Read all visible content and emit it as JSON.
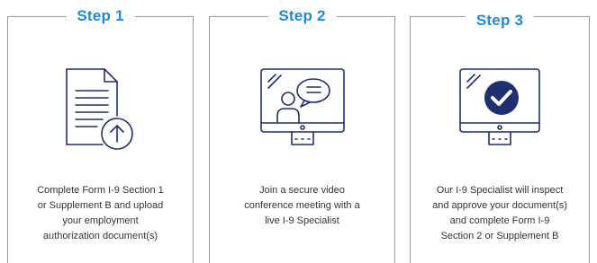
{
  "colors": {
    "accent": "#1f8bd6",
    "icon_stroke": "#1f2f6f",
    "check_fill": "#1f2f6f",
    "border": "#9a9a9a",
    "text": "#333333"
  },
  "steps": [
    {
      "title": "Step 1",
      "icon": "document-upload-icon",
      "lines": [
        "Complete Form I-9 Section 1",
        "or Supplement B and upload",
        "your employment",
        "authorization document(s)"
      ]
    },
    {
      "title": "Step 2",
      "icon": "video-conference-monitor-icon",
      "lines": [
        "Join a secure video",
        "conference meeting with a",
        "live I-9 Specialist"
      ]
    },
    {
      "title": "Step 3",
      "icon": "monitor-checkmark-icon",
      "lines": [
        "Our I-9 Specialist will inspect",
        "and approve your document(s)",
        "and complete Form I-9",
        "Section 2 or Supplement B"
      ]
    }
  ]
}
